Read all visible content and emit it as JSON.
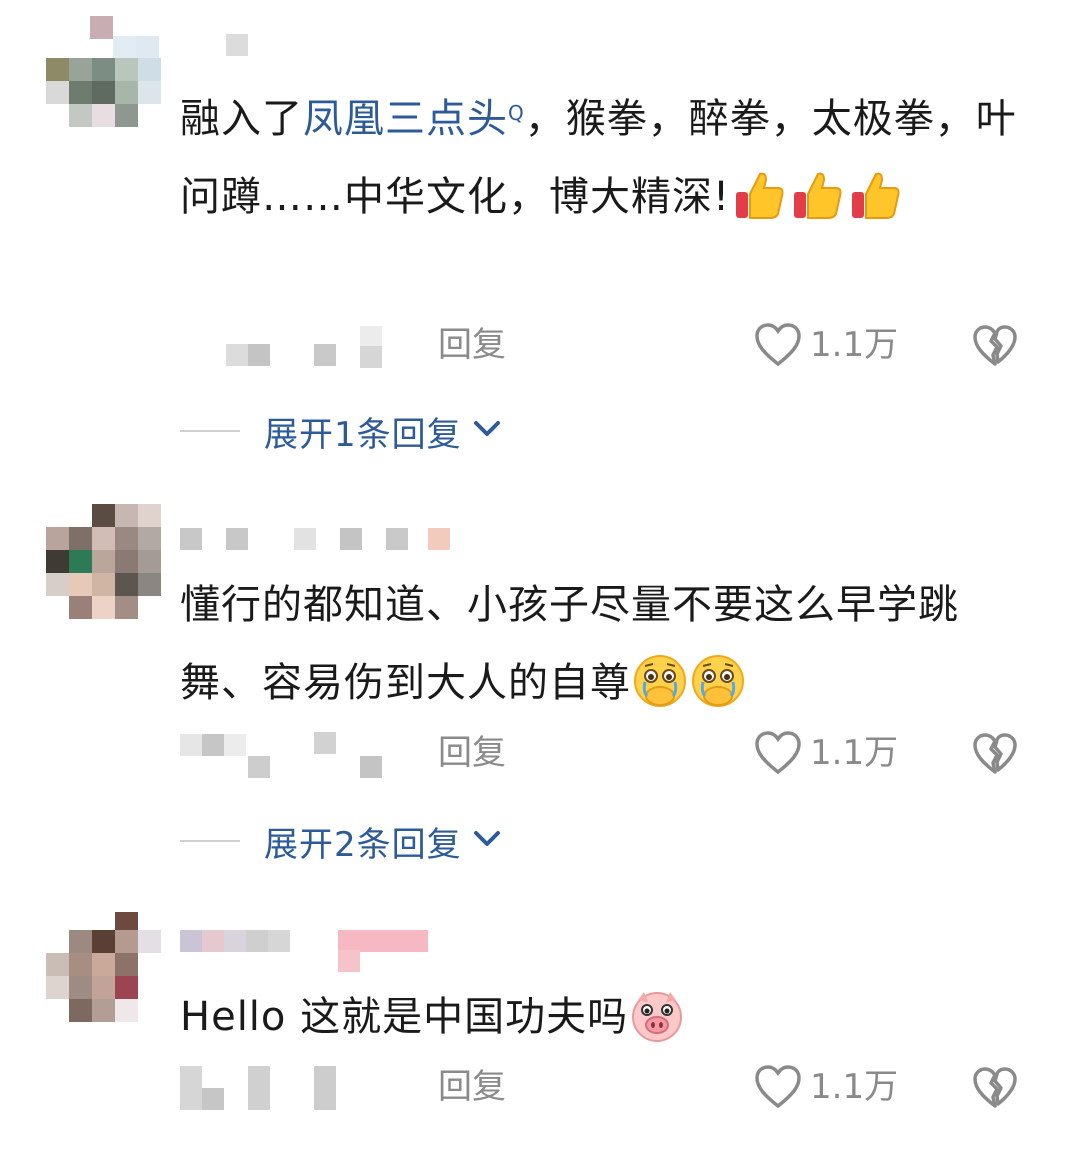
{
  "comments": [
    {
      "segments_before_link": "融入了",
      "link_text": "凤凰三点头",
      "search_mark": "Q",
      "text_after_link": "，猴拳，醉拳，太极拳，叶问蹲……中华文化，博大精深!",
      "emojis": [
        "thumbs-up",
        "thumbs-up",
        "thumbs-up"
      ],
      "reply_label": "回复",
      "like_count": "1.1万",
      "expand_label": "展开1条回复"
    },
    {
      "text": "懂行的都知道、小孩子尽量不要这么早学跳舞、容易伤到大人的自尊",
      "emojis": [
        "holding-back-tears",
        "holding-back-tears"
      ],
      "reply_label": "回复",
      "like_count": "1.1万",
      "expand_label": "展开2条回复"
    },
    {
      "text": "Hello 这就是中国功夫吗",
      "emojis": [
        "pig-face"
      ],
      "reply_label": "回复",
      "like_count": "1.1万"
    }
  ],
  "colors": {
    "link": "#2d5b9a",
    "muted": "#8a8a8a",
    "text": "#1a1a1a"
  },
  "icons": {
    "like": "heart-outline-icon",
    "dislike": "broken-heart-icon",
    "expand": "chevron-down-icon"
  }
}
